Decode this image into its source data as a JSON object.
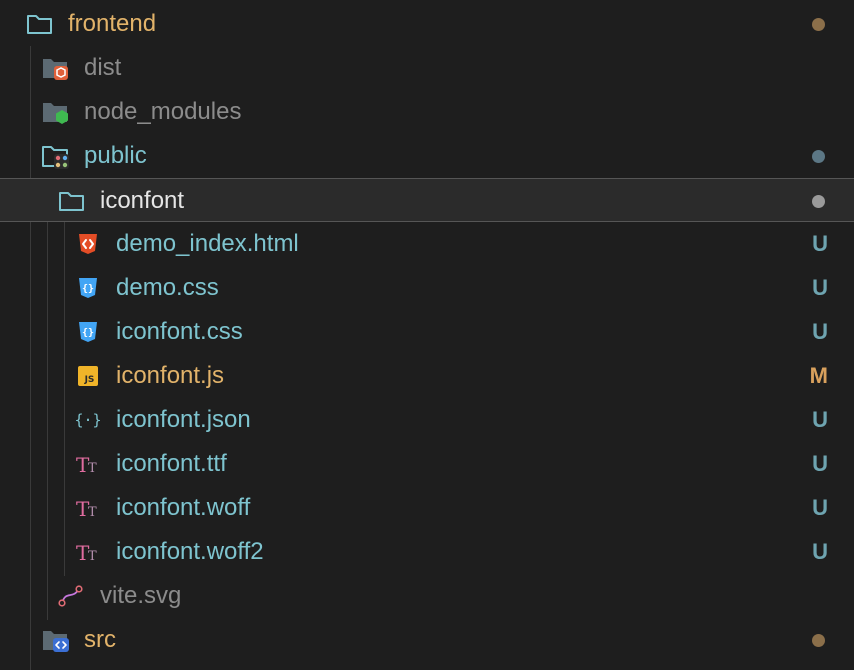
{
  "colors": {
    "background": "#1e1e1e",
    "modified": "#e2c08d",
    "untracked": "#73c991",
    "ignored": "#8c8c8c",
    "folder_text": "#7ec4cf",
    "badge_untracked": "#6ea4b0",
    "badge_modified": "#d9a15d",
    "dot_brown": "#8b6f4a",
    "dot_blue": "#5c7785",
    "dot_gray": "#9a9a9a"
  },
  "tree": {
    "frontend": {
      "label": "frontend",
      "icon": "folder-open-outline-icon",
      "status_dot": "brown"
    },
    "dist": {
      "label": "dist",
      "icon": "folder-dist-icon"
    },
    "node_modules": {
      "label": "node_modules",
      "icon": "folder-node-icon"
    },
    "public": {
      "label": "public",
      "icon": "folder-public-icon",
      "status_dot": "blue"
    },
    "iconfont_folder": {
      "label": "iconfont",
      "icon": "folder-open-outline-icon",
      "status_dot": "gray"
    },
    "files": [
      {
        "label": "demo_index.html",
        "icon": "html-file-icon",
        "badge": "U"
      },
      {
        "label": "demo.css",
        "icon": "css-file-icon",
        "badge": "U"
      },
      {
        "label": "iconfont.css",
        "icon": "css-file-icon",
        "badge": "U"
      },
      {
        "label": "iconfont.js",
        "icon": "js-file-icon",
        "badge": "M"
      },
      {
        "label": "iconfont.json",
        "icon": "json-file-icon",
        "badge": "U"
      },
      {
        "label": "iconfont.ttf",
        "icon": "font-file-icon",
        "badge": "U"
      },
      {
        "label": "iconfont.woff",
        "icon": "font-file-icon",
        "badge": "U"
      },
      {
        "label": "iconfont.woff2",
        "icon": "font-file-icon",
        "badge": "U"
      }
    ],
    "vite_svg": {
      "label": "vite.svg",
      "icon": "svg-file-icon"
    },
    "src": {
      "label": "src",
      "icon": "folder-src-icon",
      "status_dot": "brown"
    }
  }
}
